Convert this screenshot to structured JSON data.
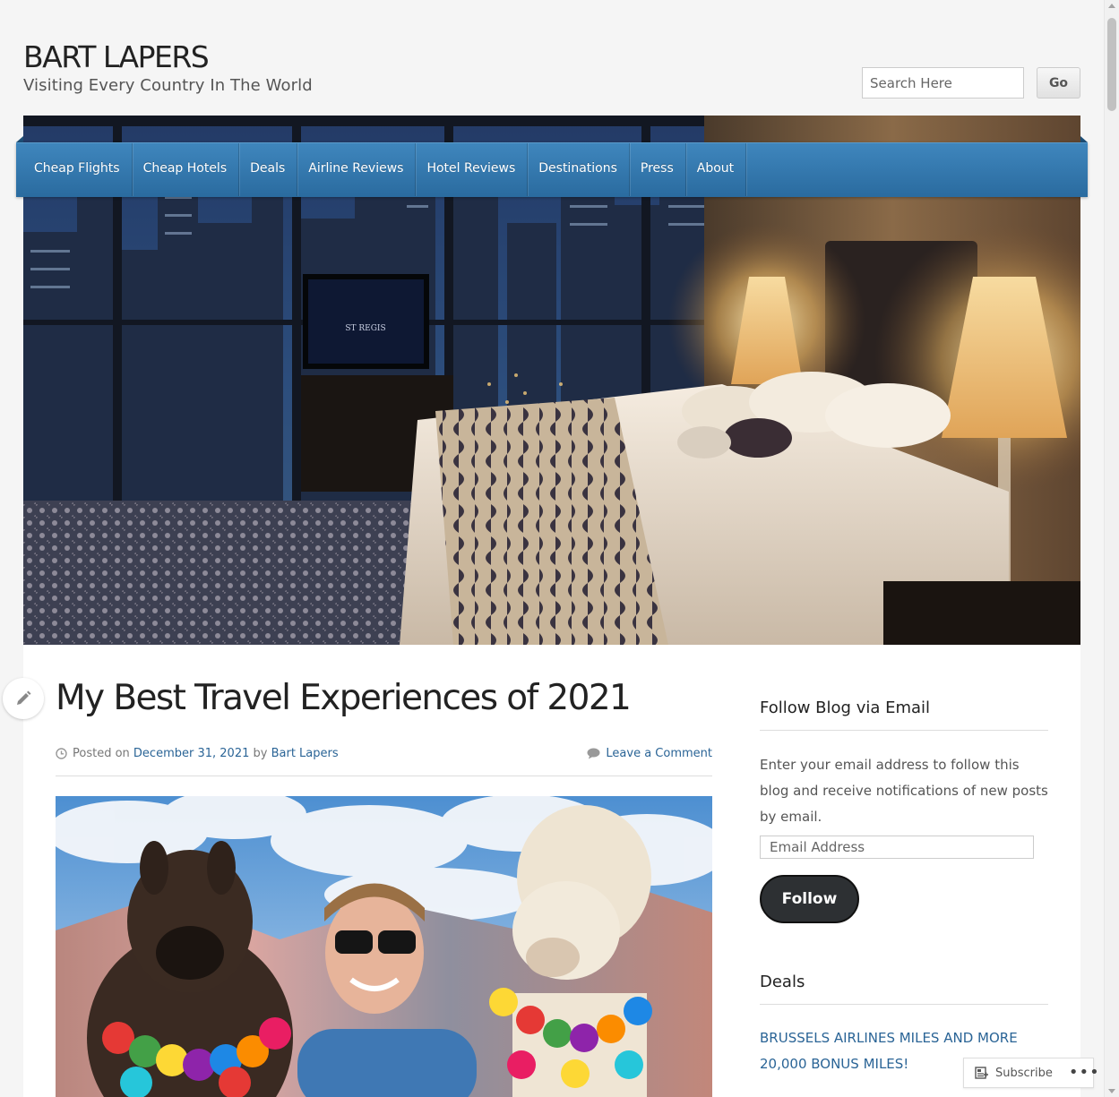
{
  "header": {
    "site_title": "BART LAPERS",
    "tagline": "Visiting Every Country In The World",
    "search_placeholder": "Search Here",
    "go_label": "Go"
  },
  "nav": {
    "items": [
      {
        "label": "Cheap Flights"
      },
      {
        "label": "Cheap Hotels"
      },
      {
        "label": "Deals"
      },
      {
        "label": "Airline Reviews"
      },
      {
        "label": "Hotel Reviews"
      },
      {
        "label": "Destinations"
      },
      {
        "label": "Press"
      },
      {
        "label": "About"
      }
    ]
  },
  "hero": {
    "tv_logo_text": "ST REGIS"
  },
  "post": {
    "title": "My Best Travel Experiences of 2021",
    "posted_on_label": "Posted on",
    "date": "December 31, 2021",
    "by_label": "by",
    "author": "Bart Lapers",
    "comment_link": "Leave a Comment"
  },
  "sidebar": {
    "follow_title": "Follow Blog via Email",
    "follow_text": "Enter your email address to follow this blog and receive notifications of new posts by email.",
    "email_placeholder": "Email Address",
    "follow_button": "Follow",
    "deals_title": "Deals",
    "deal_link": "BRUSSELS AIRLINES MILES AND MORE 20,000 BONUS MILES!"
  },
  "subscribe_bar": {
    "subscribe_label": "Subscribe",
    "more_label": "•••"
  },
  "colors": {
    "nav_blue": "#3379b0",
    "link_blue": "#2a6496",
    "follow_dark": "#2d3033"
  }
}
